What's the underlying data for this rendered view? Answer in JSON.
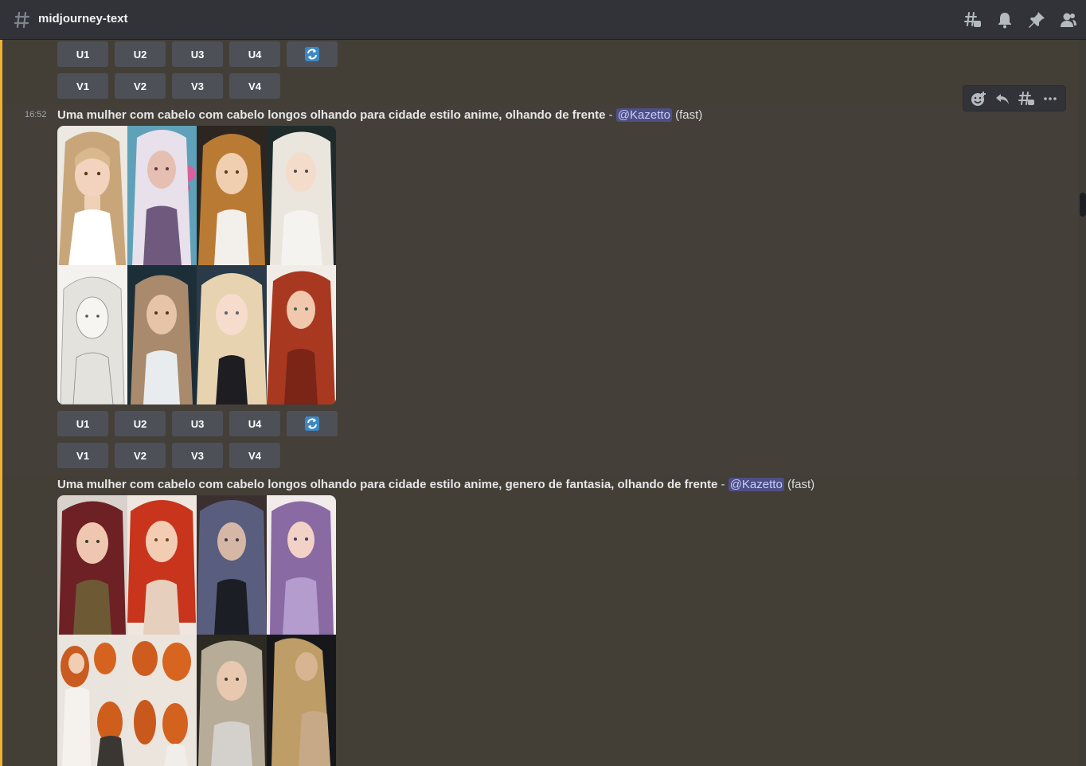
{
  "header": {
    "channel_name": "midjourney-text",
    "icons": [
      "threads-icon",
      "bell-icon",
      "pin-icon",
      "members-icon"
    ]
  },
  "toolbar_icons": [
    "add-reaction-icon",
    "reply-icon",
    "create-thread-icon",
    "more-icon"
  ],
  "buttons": {
    "upscale": [
      "U1",
      "U2",
      "U3",
      "U4"
    ],
    "variation": [
      "V1",
      "V2",
      "V3",
      "V4"
    ],
    "reroll_icon": "refresh-icon"
  },
  "messages": [
    {
      "timestamp": "16:52",
      "prompt": "Uma mulher com cabelo com cabelo longos olhando para cidade estilo anime, olhando de frente",
      "separator": " - ",
      "mention": "@Kazetto",
      "mode": "(fast)"
    },
    {
      "timestamp": "",
      "prompt": "Uma mulher com cabelo com cabelo longos olhando para cidade estilo anime, genero de fantasia, olhando de frente",
      "separator": " - ",
      "mention": "@Kazetto",
      "mode": "(fast)"
    }
  ],
  "colors": {
    "background": "#403c36",
    "header": "#313338",
    "button": "#4e5058",
    "mention_bg": "#4e4f86",
    "mention_bar": "#f0b132",
    "reroll": "#3b88c3"
  }
}
